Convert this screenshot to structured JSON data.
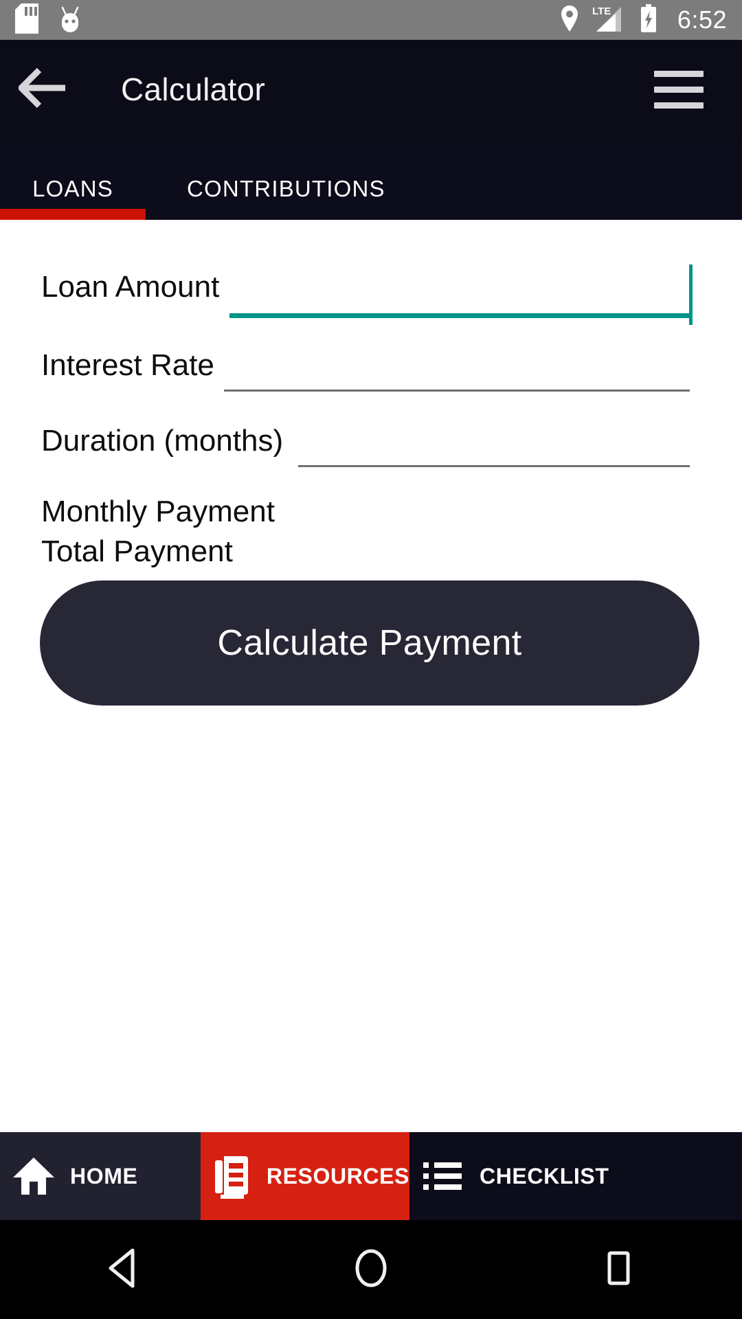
{
  "status_bar": {
    "icons_left": [
      "sd-card-icon",
      "android-mascot-icon"
    ],
    "icons_right": [
      "location-pin-icon",
      "lte-signal-icon",
      "battery-charging-icon"
    ],
    "network_label": "LTE",
    "time": "6:52",
    "background_color": "#7c7c7c"
  },
  "app_bar": {
    "back_icon": "arrow-left-icon",
    "title": "Calculator",
    "menu_icon": "hamburger-menu-icon",
    "background_color": "#0c0c18"
  },
  "tabs": {
    "items": [
      {
        "label": "LOANS",
        "selected": true
      },
      {
        "label": "CONTRIBUTIONS",
        "selected": false
      }
    ],
    "indicator_color": "#cc1205"
  },
  "form": {
    "fields": [
      {
        "label": "Loan Amount",
        "value": "",
        "focused": true,
        "underline_color": "#009487"
      },
      {
        "label": "Interest Rate",
        "value": "",
        "focused": false,
        "underline_color": "#6e6e6e"
      },
      {
        "label": "Duration (months)",
        "value": "",
        "focused": false,
        "underline_color": "#6e6e6e"
      }
    ],
    "results": [
      {
        "label": "Monthly Payment",
        "value": ""
      },
      {
        "label": "Total Payment",
        "value": ""
      }
    ],
    "submit_label": "Calculate Payment",
    "submit_color": "#272736"
  },
  "bottom_nav": {
    "items": [
      {
        "label": "HOME",
        "icon": "home-icon",
        "active": false,
        "background": "#21212f"
      },
      {
        "label": "RESOURCES",
        "icon": "library-book-icon",
        "active": true,
        "background": "#d62112"
      },
      {
        "label": "CHECKLIST",
        "icon": "list-icon",
        "active": false,
        "background": "#0c0c1a"
      }
    ]
  },
  "system_nav": {
    "buttons": [
      {
        "name": "back",
        "icon": "triangle-back-icon"
      },
      {
        "name": "home",
        "icon": "circle-home-icon"
      },
      {
        "name": "recents",
        "icon": "square-recents-icon"
      }
    ],
    "background_color": "#000000"
  }
}
